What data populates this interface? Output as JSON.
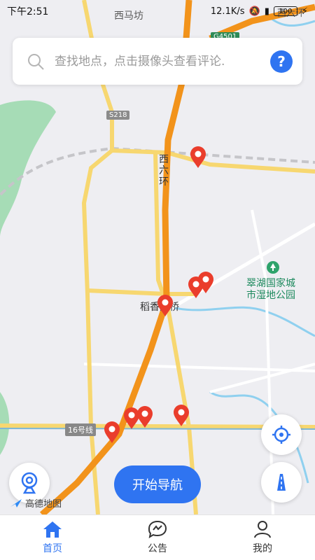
{
  "status_bar": {
    "time": "下午2:51",
    "network_speed": "12.1K/s",
    "battery": "100"
  },
  "search": {
    "placeholder": "查找地点，点击摄像头查看评论.",
    "help_label": "?"
  },
  "map": {
    "labels": {
      "top_area": "西马坊",
      "ring_road": "西六环",
      "ring_road_top": "西六环",
      "bridge": "稻香湖桥",
      "park_line1": "翠湖国家城",
      "park_line2": "市湿地公园"
    },
    "road_codes": {
      "s218": "S218",
      "g4501": "G4501",
      "line16": "16号线"
    },
    "camera_marker_count": 8,
    "colors": {
      "highway": "#f2931b",
      "major_road": "#f7d770",
      "water": "#8fd0ef",
      "greenery": "#9fd9b0",
      "marker": "#ea3d2c"
    }
  },
  "start_navigation": "开始导航",
  "brand": "高德地图",
  "tabs": [
    {
      "label": "首页",
      "icon": "home-icon",
      "active": true
    },
    {
      "label": "公告",
      "icon": "announcement-icon",
      "active": false
    },
    {
      "label": "我的",
      "icon": "profile-icon",
      "active": false
    }
  ]
}
